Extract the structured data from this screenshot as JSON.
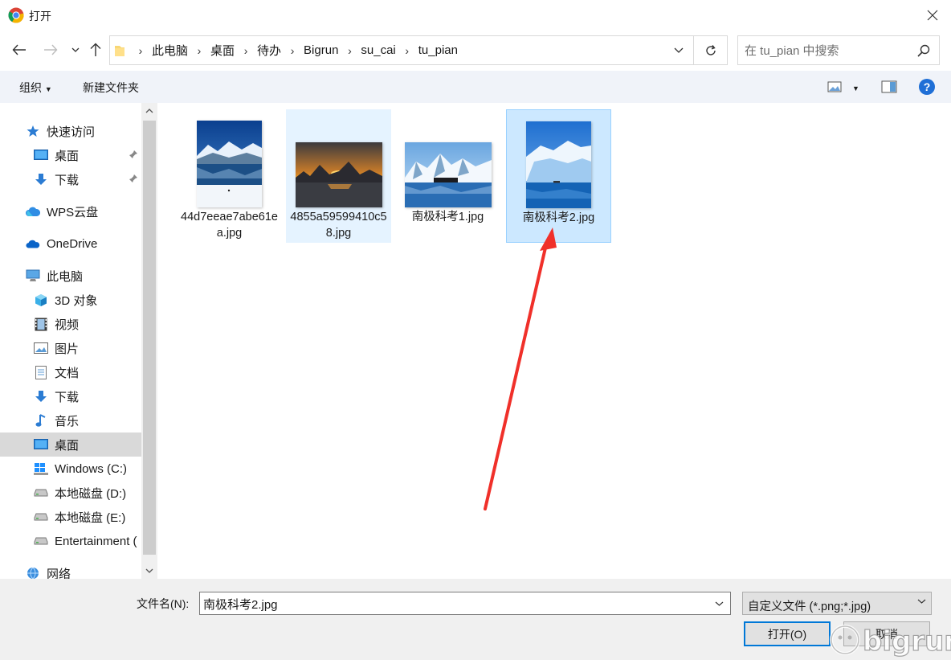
{
  "window": {
    "title": "打开"
  },
  "breadcrumbs": [
    "此电脑",
    "桌面",
    "待办",
    "Bigrun",
    "su_cai",
    "tu_pian"
  ],
  "search": {
    "placeholder": "在 tu_pian 中搜索"
  },
  "toolbar": {
    "organize_label": "组织",
    "new_folder_label": "新建文件夹",
    "help_label": "?"
  },
  "sidebar": {
    "items": [
      {
        "label": "快速访问",
        "icon": "star-icon"
      },
      {
        "label": "桌面",
        "icon": "desktop-icon",
        "pinned": true
      },
      {
        "label": "下载",
        "icon": "download-icon",
        "pinned": true
      },
      {
        "label": "WPS云盘",
        "icon": "cloud-icon"
      },
      {
        "label": "OneDrive",
        "icon": "onedrive-icon"
      },
      {
        "label": "此电脑",
        "icon": "computer-icon"
      },
      {
        "label": "3D 对象",
        "icon": "cube-icon"
      },
      {
        "label": "视频",
        "icon": "video-icon"
      },
      {
        "label": "图片",
        "icon": "pictures-icon"
      },
      {
        "label": "文档",
        "icon": "document-icon"
      },
      {
        "label": "下载",
        "icon": "download-icon"
      },
      {
        "label": "音乐",
        "icon": "music-icon"
      },
      {
        "label": "桌面",
        "icon": "desktop-icon",
        "selected": true
      },
      {
        "label": "Windows (C:)",
        "icon": "windows-drive-icon"
      },
      {
        "label": "本地磁盘 (D:)",
        "icon": "drive-icon"
      },
      {
        "label": "本地磁盘 (E:)",
        "icon": "drive-icon"
      },
      {
        "label": "Entertainment (",
        "icon": "drive-icon"
      },
      {
        "label": "网络",
        "icon": "network-icon"
      }
    ]
  },
  "files": [
    {
      "name": "44d7eeae7abe61ea.jpg",
      "state": "normal"
    },
    {
      "name": "4855a59599410c58.jpg",
      "state": "hover"
    },
    {
      "name": "南极科考1.jpg",
      "state": "normal"
    },
    {
      "name": "南极科考2.jpg",
      "state": "selected"
    }
  ],
  "footer": {
    "filename_label": "文件名(N):",
    "filename_value": "南极科考2.jpg",
    "filetype_label": "自定义文件 (*.png;*.jpg)",
    "open_label": "打开(O)",
    "cancel_label": "取消"
  },
  "watermark": "bigrun",
  "colors": {
    "accent": "#0078d7",
    "selection": "#cce8ff",
    "arrow": "#f0302a"
  }
}
